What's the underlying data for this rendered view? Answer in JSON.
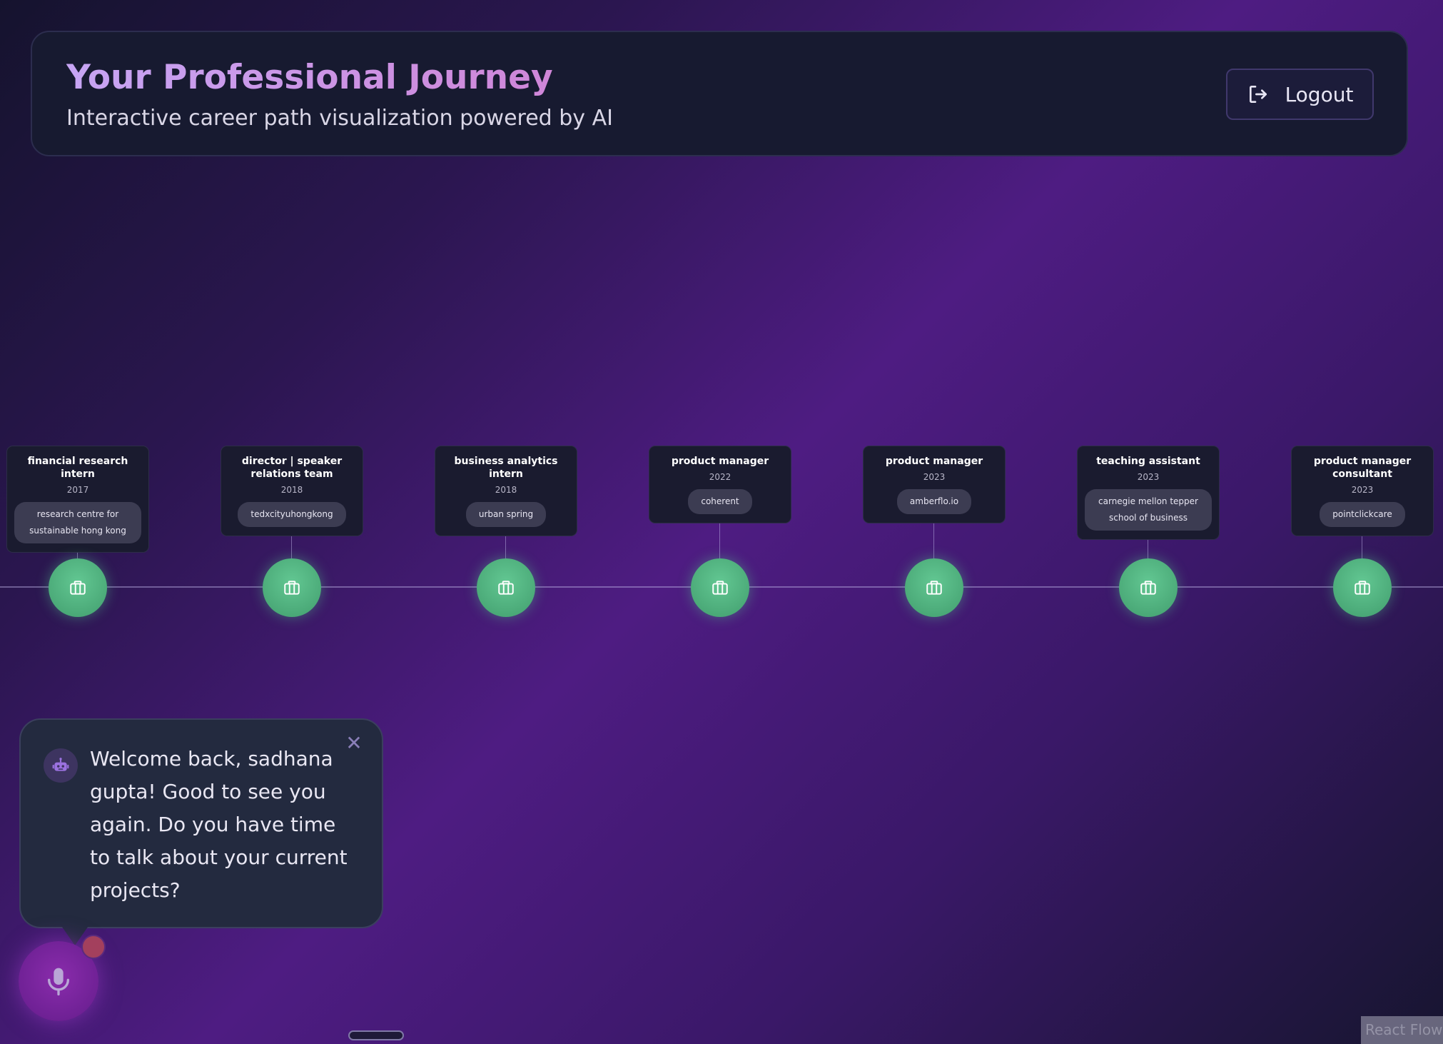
{
  "header": {
    "title": "Your Professional Journey",
    "subtitle": "Interactive career path visualization powered by AI",
    "logout_label": "Logout"
  },
  "timeline": [
    {
      "role": "financial research intern",
      "year": "2017",
      "company": "research centre for sustainable hong kong"
    },
    {
      "role": "director | speaker relations team",
      "year": "2018",
      "company": "tedxcityuhongkong"
    },
    {
      "role": "business analytics intern",
      "year": "2018",
      "company": "urban spring"
    },
    {
      "role": "product manager",
      "year": "2022",
      "company": "coherent"
    },
    {
      "role": "product manager",
      "year": "2023",
      "company": "amberflo.io"
    },
    {
      "role": "teaching assistant",
      "year": "2023",
      "company": "carnegie mellon tepper school of business"
    },
    {
      "role": "product manager consultant",
      "year": "2023",
      "company": "pointclickcare"
    }
  ],
  "assistant": {
    "message": "Welcome back, sadhana gupta! Good to see you again. Do you have time to talk about your current projects?",
    "close_glyph": "✕",
    "icon": "robot-icon",
    "mic_icon": "microphone-icon"
  },
  "attribution": "React Flow",
  "colors": {
    "node_green": "#52b883",
    "mic_purple": "#7a26a0",
    "title_gradient_start": "#c7a5f4",
    "title_gradient_end": "#cf86d8"
  }
}
